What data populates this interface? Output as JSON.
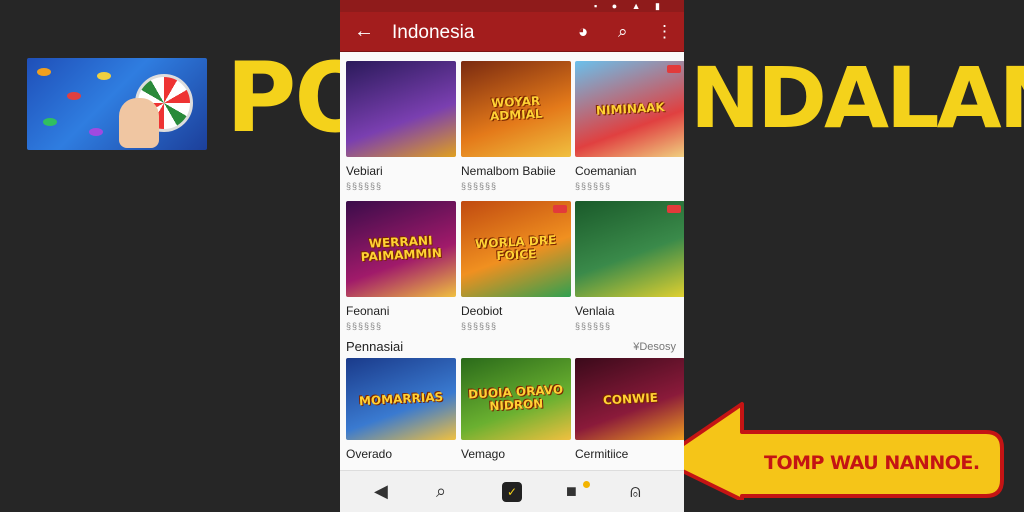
{
  "banner": {
    "left_text": "PO",
    "right_text": "NDALAN",
    "callout_text": "TOMP WAU NANNOE."
  },
  "status_bar": {
    "icons": [
      "signal-icon",
      "alarm-icon",
      "wifi-icon",
      "battery-icon"
    ]
  },
  "app_bar": {
    "title": "Indonesia",
    "actions": [
      "chat-icon",
      "search-icon",
      "more-icon"
    ]
  },
  "grid": {
    "rows": [
      [
        {
          "art_text": "",
          "name": "Vebiari",
          "sub": "§§§§§§",
          "colors": [
            "#2a1a5a",
            "#7a3fb0",
            "#e0a020"
          ]
        },
        {
          "art_text": "WOYAR ADMIAL",
          "name": "Nemalbom Babiie",
          "sub": "§§§§§§",
          "colors": [
            "#7a2a10",
            "#e47a1a",
            "#f0c040"
          ]
        },
        {
          "art_text": "NIMINAAK",
          "name": "Coemanian",
          "sub": "§§§§§§",
          "colors": [
            "#6ac0ec",
            "#e04040",
            "#f0d080"
          ]
        }
      ],
      [
        {
          "art_text": "WERRANI PAIMAMMIN",
          "name": "Feonani",
          "sub": "§§§§§§",
          "colors": [
            "#3a0c4a",
            "#a01a6a",
            "#f0c040"
          ]
        },
        {
          "art_text": "WORLA DRE FOICE",
          "name": "Deobiot",
          "sub": "§§§§§§",
          "colors": [
            "#c04a10",
            "#f09020",
            "#30a050"
          ]
        },
        {
          "art_text": "",
          "name": "Venlaia",
          "sub": "§§§§§§",
          "colors": [
            "#1a5a2a",
            "#3a8a4a",
            "#e0d030"
          ]
        }
      ]
    ]
  },
  "section": {
    "title": "Pennasiai",
    "more": "¥Desosy",
    "tiles": [
      {
        "art_text": "MOMARRIAS",
        "name": "Overado",
        "sub": "",
        "colors": [
          "#1a3a8a",
          "#3a7ad0",
          "#f0c040"
        ]
      },
      {
        "art_text": "DUOIA ORAVO NIDRON",
        "name": "Vemago",
        "sub": "",
        "colors": [
          "#2a6a1a",
          "#6ab030",
          "#f0c040"
        ]
      },
      {
        "art_text": "CONWIE",
        "name": "Cermitiice",
        "sub": "",
        "colors": [
          "#3a0a1a",
          "#8a1a3a",
          "#f0a020"
        ]
      }
    ]
  },
  "bottom_nav": {
    "items": [
      "back-icon",
      "search-icon",
      "home-icon",
      "inbox-icon",
      "profile-icon"
    ]
  }
}
